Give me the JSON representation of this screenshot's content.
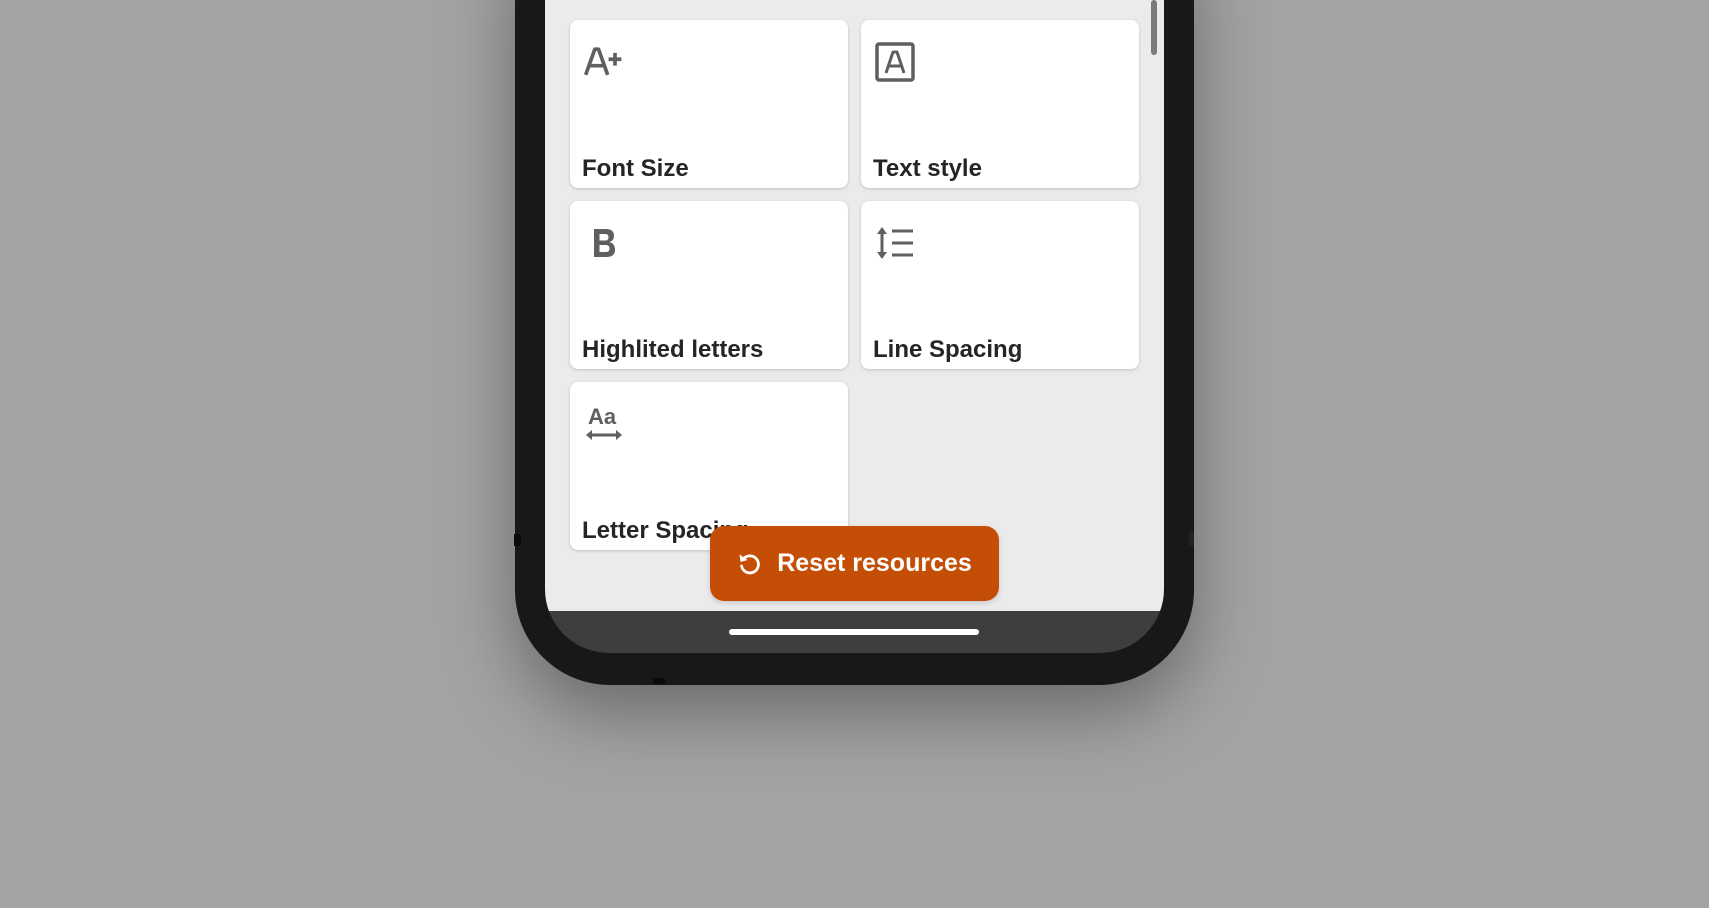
{
  "colors": {
    "background": "#a3a3a3",
    "screen": "#ebebeb",
    "card": "#ffffff",
    "icon": "#5f5f5f",
    "label": "#252525",
    "accent": "#c44e06"
  },
  "cards": [
    {
      "label": "Font Size",
      "icon": "font-size-increase-icon"
    },
    {
      "label": "Text style",
      "icon": "text-style-icon"
    },
    {
      "label": "Highlited letters",
      "icon": "bold-icon"
    },
    {
      "label": "Line Spacing",
      "icon": "line-spacing-icon"
    },
    {
      "label": "Letter Spacing",
      "icon": "letter-spacing-icon"
    }
  ],
  "reset_button": {
    "label": "Reset resources",
    "icon": "reset-icon"
  }
}
